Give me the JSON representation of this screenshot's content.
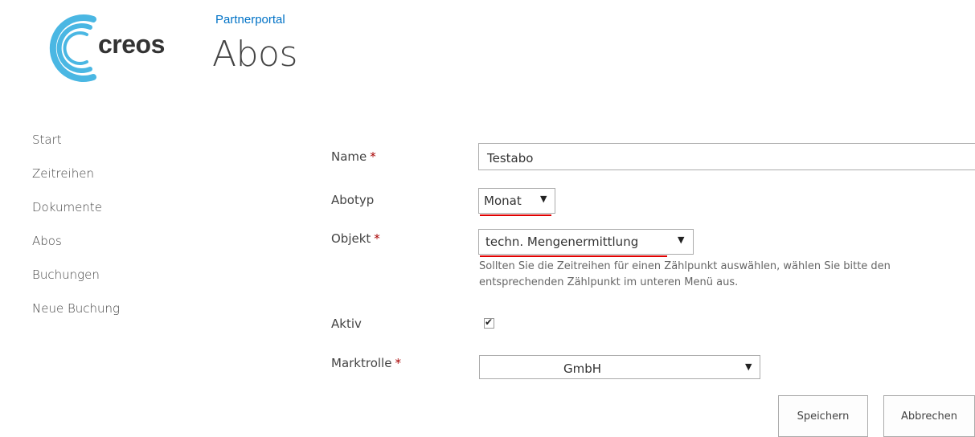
{
  "header": {
    "logo_text": "creos",
    "site_link": "Partnerportal",
    "page_title": "Abos"
  },
  "nav": {
    "items": [
      {
        "label": "Start"
      },
      {
        "label": "Zeitreihen"
      },
      {
        "label": "Dokumente"
      },
      {
        "label": "Abos"
      },
      {
        "label": "Buchungen"
      },
      {
        "label": "Neue Buchung"
      }
    ]
  },
  "form": {
    "name": {
      "label": "Name",
      "required_marker": "*",
      "value": "Testabo"
    },
    "abotyp": {
      "label": "Abotyp",
      "value": "Monat"
    },
    "objekt": {
      "label": "Objekt",
      "required_marker": "*",
      "value": "techn. Mengenermittlung",
      "help": "Sollten Sie die Zeitreihen für einen Zählpunkt auswählen, wählen Sie bitte den entsprechenden Zählpunkt im unteren Menü aus."
    },
    "aktiv": {
      "label": "Aktiv",
      "checked": true
    },
    "marktrolle": {
      "label": "Marktrolle",
      "required_marker": "*",
      "value": "GmbH"
    },
    "dropdown_arrow": "▼",
    "checkmark": "✔"
  },
  "buttons": {
    "save": "Speichern",
    "cancel": "Abbrechen"
  },
  "colors": {
    "accent_link": "#0072c6",
    "required": "#a80000",
    "highlight_underline": "#e00000",
    "logo_blue": "#4ab7e3"
  }
}
